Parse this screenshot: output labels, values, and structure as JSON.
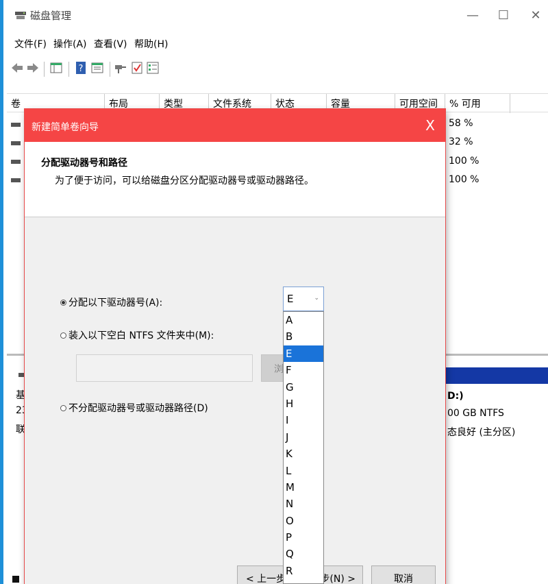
{
  "window": {
    "title": "磁盘管理",
    "minimize": "—",
    "maximize": "☐",
    "close": "✕"
  },
  "menu": [
    "文件(F)",
    "操作(A)",
    "查看(V)",
    "帮助(H)"
  ],
  "volume_table": {
    "columns": [
      "卷",
      "布局",
      "类型",
      "文件系统",
      "状态",
      "容量",
      "可用空间",
      "% 可用"
    ],
    "percent_free": [
      "58 %",
      "32 %",
      "100 %",
      "100 %"
    ]
  },
  "disk_pane": {
    "left_labels": [
      "基",
      "23",
      "联"
    ],
    "volume_name": "D:)",
    "volume_size": "00 GB NTFS",
    "volume_status": "态良好 (主分区)"
  },
  "wizard": {
    "title": "新建简单卷向导",
    "close": "X",
    "heading": "分配驱动器号和路径",
    "description": "为了便于访问，可以给磁盘分区分配驱动器号或驱动器路径。",
    "option_assign": "分配以下驱动器号(A):",
    "option_mount": "装入以下空白 NTFS 文件夹中(M):",
    "option_none": "不分配驱动器号或驱动器路径(D)",
    "browse": "浏",
    "back": "< 上一步(",
    "next": "步(N) >",
    "cancel": "取消",
    "selected_letter": "E",
    "letters": [
      "A",
      "B",
      "E",
      "F",
      "G",
      "H",
      "I",
      "J",
      "K",
      "L",
      "M",
      "N",
      "O",
      "P",
      "Q",
      "R"
    ]
  }
}
